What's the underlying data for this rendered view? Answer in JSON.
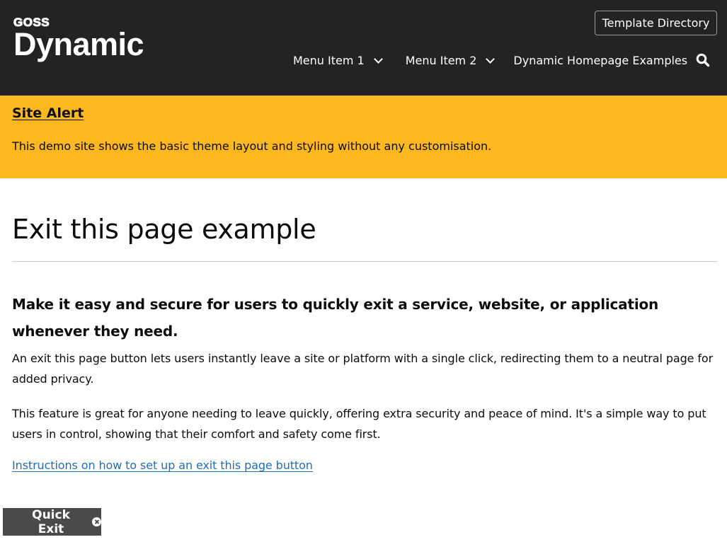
{
  "header": {
    "logo": {
      "brand": "GOSS",
      "product": "Dynamic"
    },
    "template_directory_label": "Template Directory",
    "nav": [
      {
        "label": "Menu Item 1",
        "has_dropdown": true
      },
      {
        "label": "Menu Item 2",
        "has_dropdown": true
      },
      {
        "label": "Dynamic Homepage Examples",
        "has_dropdown": false
      }
    ],
    "search_icon": "search-icon"
  },
  "alert": {
    "title": "Site Alert",
    "text": "This demo site shows the basic theme layout and styling without any customisation.",
    "background": "#feb81f"
  },
  "main": {
    "title": "Exit this page example",
    "subheading": "Make it easy and secure for users to quickly exit a service, website, or application whenever they need.",
    "paragraphs": [
      "An exit this page button lets users instantly leave a site or platform with a single click, redirecting them to a neutral page for added privacy.",
      "This feature is great for anyone needing to leave quickly, offering extra security and peace of mind. It's a simple way to put users in control, showing that their comfort and safety come first."
    ],
    "link": "Instructions on how to set up an exit this page button"
  },
  "quick_exit": {
    "label": "Quick Exit",
    "icon": "close-circle-icon"
  },
  "colors": {
    "header_bg": "#232323",
    "alert_bg": "#feb81f",
    "link": "#1d70b8",
    "quick_exit_bg": "#4a4a4a"
  }
}
